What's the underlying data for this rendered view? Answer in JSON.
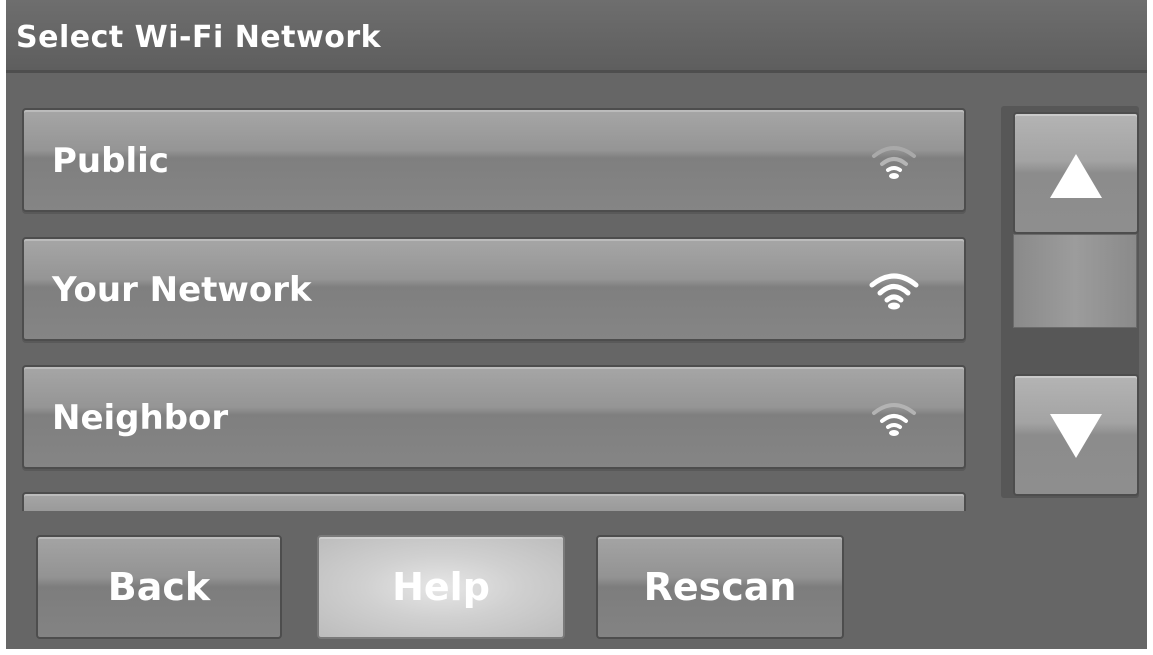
{
  "header": {
    "title": "Select Wi-Fi Network"
  },
  "networks": [
    {
      "label": "Public",
      "signal_icon": "wifi-weak-icon",
      "signal_strength": "weak"
    },
    {
      "label": "Your Network",
      "signal_icon": "wifi-strong-icon",
      "signal_strength": "strong"
    },
    {
      "label": "Neighbor",
      "signal_icon": "wifi-weak-icon",
      "signal_strength": "weak"
    },
    {
      "label": "",
      "signal_icon": "",
      "signal_strength": ""
    }
  ],
  "scrollbar": {
    "up_icon": "triangle-up-icon",
    "down_icon": "triangle-down-icon"
  },
  "buttons": {
    "back": "Back",
    "help": "Help",
    "rescan": "Rescan"
  },
  "colors": {
    "screen_bg": "#6b6b6b",
    "button_face": "#9a9a9a",
    "highlight_button": "#d0d0d0",
    "text": "#ffffff"
  }
}
